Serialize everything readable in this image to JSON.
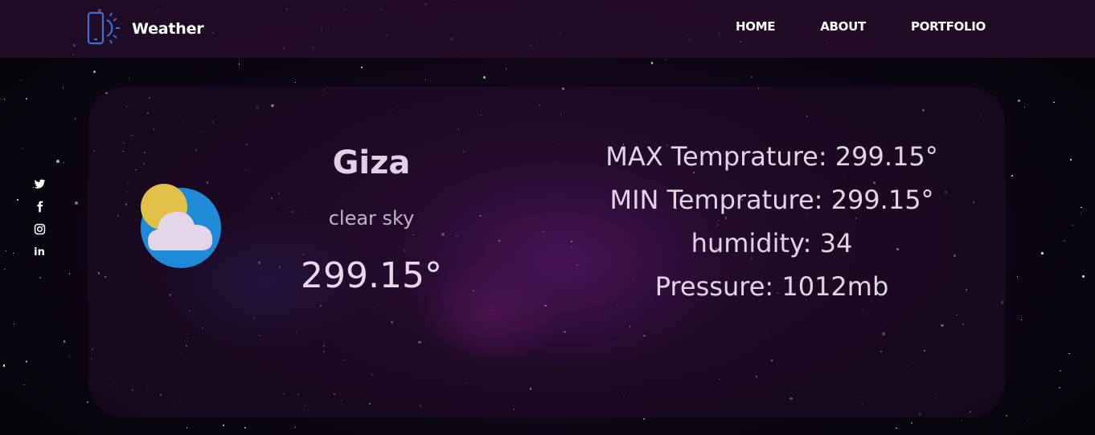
{
  "header": {
    "brand": "Weather",
    "nav": [
      "HOME",
      "ABOUT",
      "PORTFOLIO"
    ]
  },
  "social": {
    "icons": [
      "twitter-icon",
      "facebook-icon",
      "instagram-icon",
      "linkedin-icon"
    ],
    "linkedin_label": "in"
  },
  "weather": {
    "city": "Giza",
    "description": "clear sky",
    "temperature": "299.15°",
    "icon": "partly-cloudy-icon"
  },
  "details": {
    "max": "MAX Temprature: 299.15°",
    "min": "MIN Temprature: 299.15°",
    "humidity": "humidity: 34",
    "pressure": "Pressure: 1012mb"
  },
  "colors": {
    "brand_icon": "#3a6fd8",
    "sun": "#e0c046",
    "sky_circle": "#1e8ad8",
    "cloud": "#e4d6e8"
  }
}
